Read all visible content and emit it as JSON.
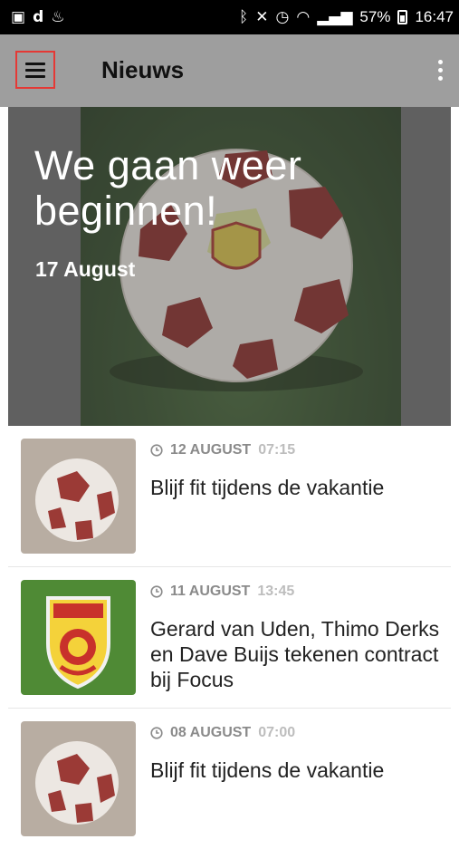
{
  "status_bar": {
    "left_icons": [
      "image-icon",
      "d-icon",
      "notification-icon"
    ],
    "right_icons": [
      "bluetooth-icon",
      "mute-icon",
      "alarm-icon",
      "wifi-icon",
      "signal-icon"
    ],
    "battery": "57%",
    "battery_level": 0.57,
    "time": "16:47"
  },
  "app_bar": {
    "title": "Nieuws",
    "menu_icon": "hamburger-menu-icon",
    "overflow_icon": "more-vert-icon",
    "background": "#9e9e9e"
  },
  "hero": {
    "title": "We gaan weer beginnen!",
    "date": "17 August"
  },
  "articles": [
    {
      "date": "12 AUGUST",
      "time": "07:15",
      "title": "Blijf fit tijdens de vakantie",
      "thumb": "soccer-ball-sand"
    },
    {
      "date": "11 AUGUST",
      "time": "13:45",
      "title": "Gerard van Uden, Thimo Derks en Dave Buijs tekenen contract bij Focus",
      "thumb": "focus-crest-grass"
    },
    {
      "date": "08 AUGUST",
      "time": "07:00",
      "title": "Blijf fit tijdens de vakantie",
      "thumb": "soccer-ball-sand"
    }
  ],
  "colors": {
    "menu_highlight": "#e53935",
    "meta_date": "#8a8a8a",
    "meta_time": "#bdbdbd"
  }
}
